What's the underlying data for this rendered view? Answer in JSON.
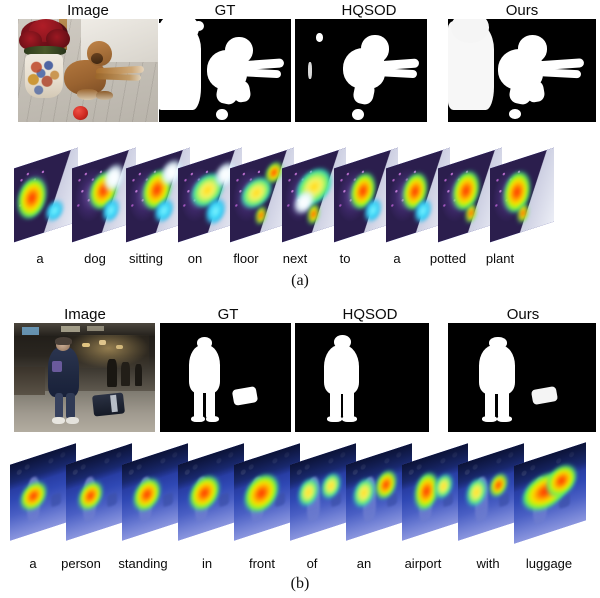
{
  "figure": {
    "columns": [
      "Image",
      "GT",
      "HQSOD",
      "Ours"
    ],
    "subfigures": [
      {
        "id": "a",
        "caption": "(a)",
        "columns": [
          "Image",
          "GT",
          "HQSOD",
          "Ours"
        ],
        "caption_words": [
          "a",
          "dog",
          "sitting",
          "on",
          "floor",
          "next",
          "to",
          "a",
          "potted",
          "plant"
        ]
      },
      {
        "id": "b",
        "caption": "(b)",
        "columns": [
          "Image",
          "GT",
          "HQSOD",
          "Ours"
        ],
        "caption_words": [
          "a",
          "person",
          "standing",
          "in",
          "front",
          "of",
          "an",
          "airport",
          "with",
          "luggage"
        ]
      }
    ]
  },
  "colors": {
    "background": "#ffffff",
    "mask_foreground": "#ffffff",
    "mask_background": "#000000",
    "text": "#0b0b0b",
    "heatmap_hot": "#ff2a00",
    "heatmap_warm": "#ffe000",
    "heatmap_cool": "#19c6f2",
    "heatmap_base": "#4a5fc4"
  }
}
